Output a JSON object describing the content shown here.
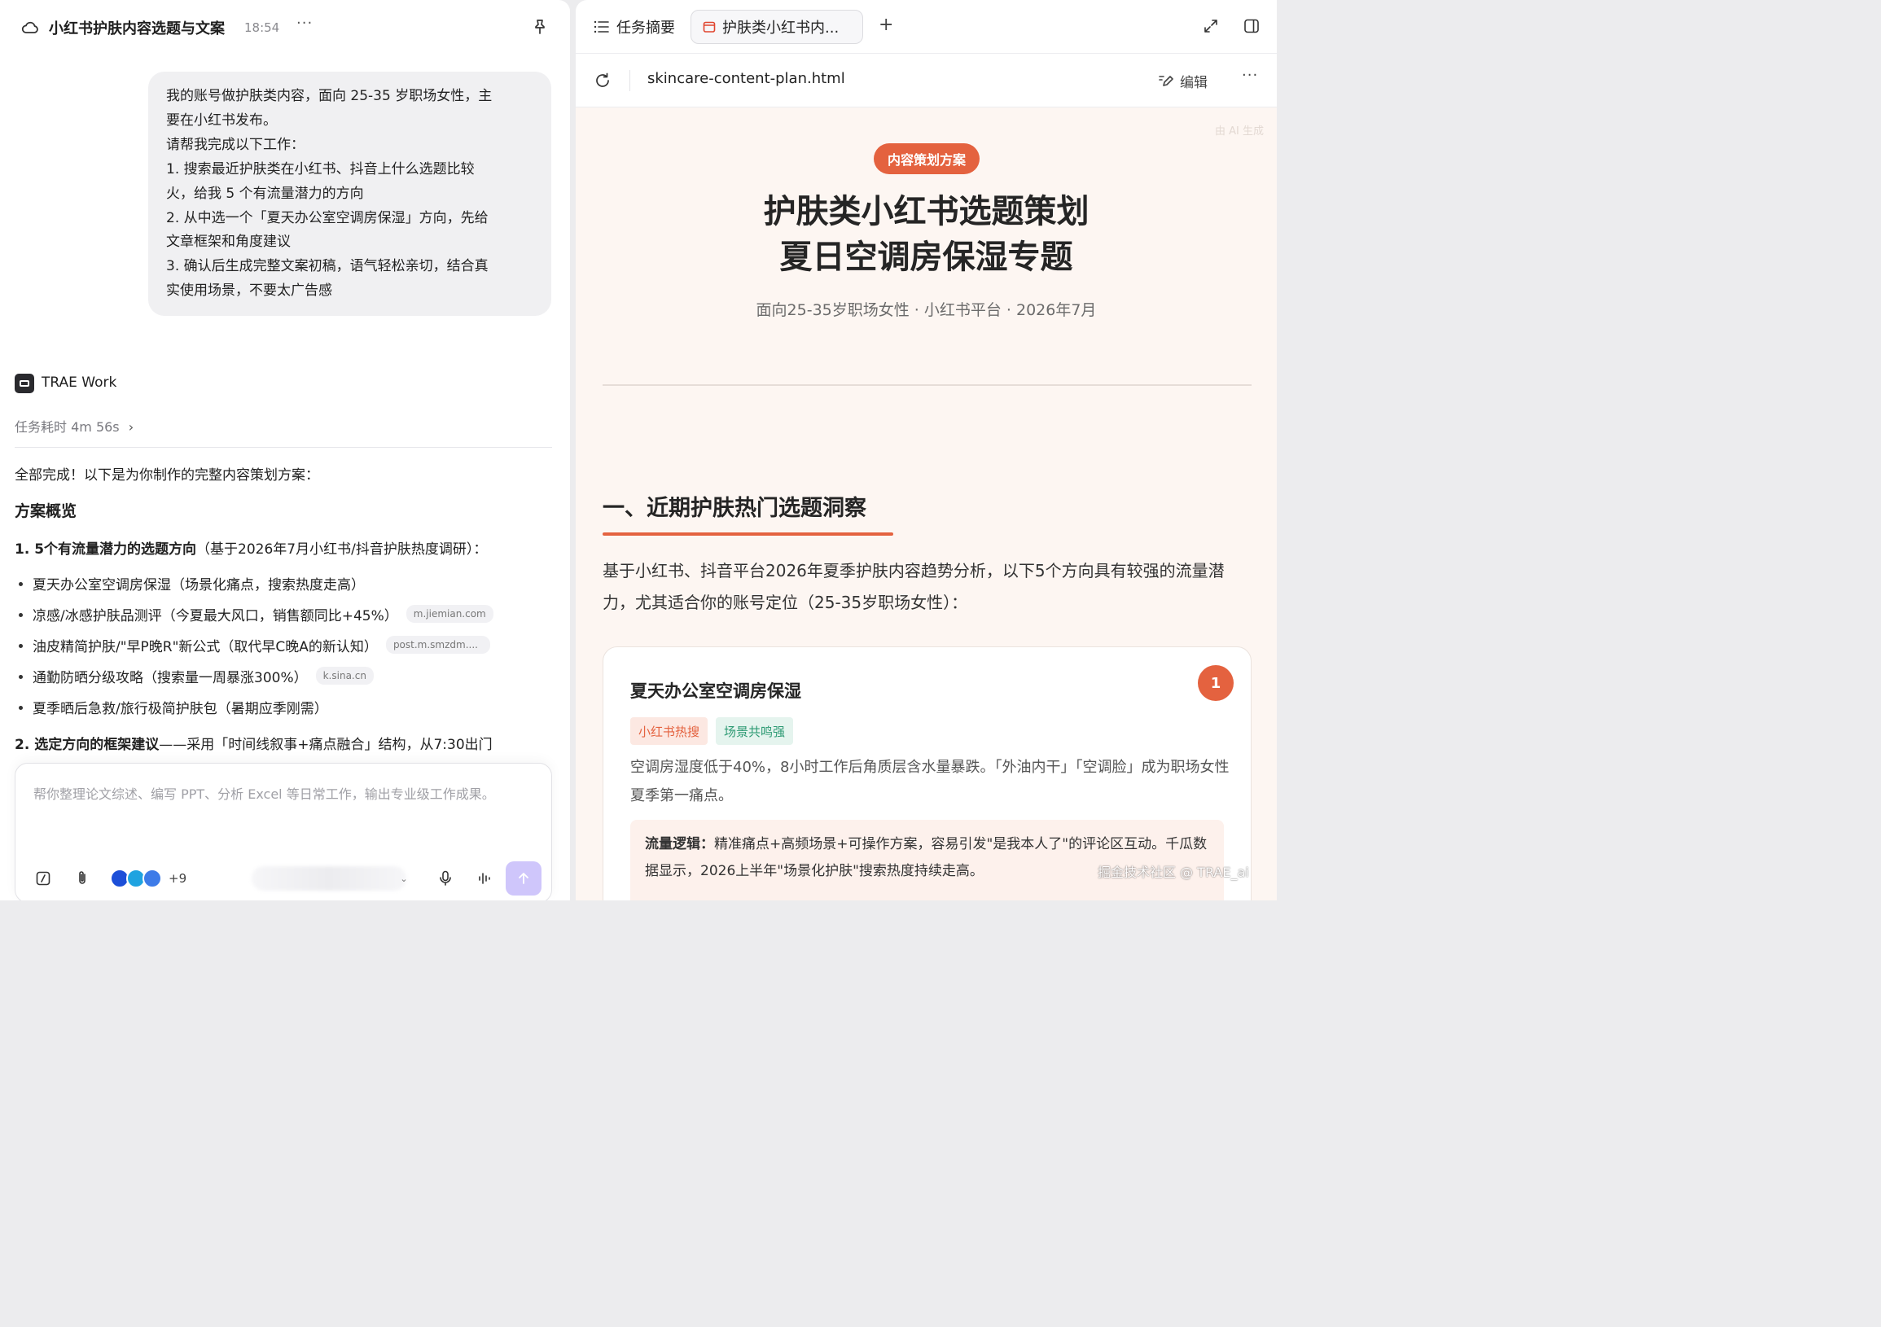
{
  "left_panel": {
    "header": {
      "title": "小红书护肤内容选题与文案",
      "time": "18:54",
      "more": "···"
    },
    "user_message": {
      "lines": [
        "我的账号做护肤类内容，面向 25-35 岁职场女性，主",
        "要在小红书发布。",
        "请帮我完成以下工作：",
        "1. 搜索最近护肤类在小红书、抖音上什么选题比较",
        "火，给我 5 个有流量潜力的方向",
        "2. 从中选一个「夏天办公室空调房保湿」方向，先给",
        "文章框架和角度建议",
        "3. 确认后生成完整文案初稿，语气轻松亲切，结合真",
        "实使用场景，不要太广告感"
      ]
    },
    "agent": {
      "name": "TRAE Work",
      "duration": "任务耗时 4m 56s",
      "duration_chevron": "›"
    },
    "response": {
      "done": "全部完成！以下是为你制作的完整内容策划方案：",
      "overview_heading": "方案概览",
      "section1_bold": "1. 5个有流量潜力的选题方向",
      "section1_rest": "（基于2026年7月小红书/抖音护肤热度调研）：",
      "bullets": [
        {
          "text": "夏天办公室空调房保湿（场景化痛点，搜索热度走高）",
          "source": ""
        },
        {
          "text": "凉感/冰感护肤品测评（今夏最大风口，销售额同比+45%）",
          "source": "m.jiemian.com"
        },
        {
          "text": "油皮精简护肤/\"早P晚R\"新公式（取代早C晚A的新认知）",
          "source": "post.m.smzdm...."
        },
        {
          "text": "通勤防晒分级攻略（搜索量一周暴涨300%）",
          "source": "k.sina.cn"
        },
        {
          "text": "夏季晒后急救/旅行极简护肤包（暑期应季刚需）",
          "source": ""
        }
      ],
      "section2_bold": "2. 选定方向的框架建议",
      "section2_rest": "——采用「时间线叙事+痛点融合」结构，从7:30出门"
    },
    "composer": {
      "placeholder": "帮你整理论文综述、编写 PPT、分析 Excel 等日常工作，输出专业级工作成果。",
      "more_apps": "+9",
      "caret": "⌄"
    }
  },
  "right_panel": {
    "tabs": {
      "summary_label": "任务摘要",
      "file_tab_label": "护肤类小红书内...",
      "add": "+"
    },
    "address": {
      "url": "skincare-content-plan.html",
      "edit_label": "编辑",
      "more": "···"
    },
    "doc": {
      "ai_generated": "由 AI 生成",
      "badge": "内容策划方案",
      "title_line1": "护肤类小红书选题策划",
      "title_line2": "夏日空调房保湿专题",
      "subtitle": "面向25-35岁职场女性 · 小红书平台 · 2026年7月",
      "section_title": "一、近期护肤热门选题洞察",
      "section_intro": "基于小红书、抖音平台2026年夏季护肤内容趋势分析，以下5个方向具有较强的流量潜力，尤其适合你的账号定位（25-35岁职场女性）：",
      "card": {
        "number": "1",
        "title": "夏天办公室空调房保湿",
        "tags": [
          "小红书热搜",
          "场景共鸣强"
        ],
        "description": "空调房湿度低于40%，8小时工作后角质层含水量暴跌。「外油内干」「空调脸」成为职场女性夏季第一痛点。",
        "logic_label": "流量逻辑：",
        "logic_text": "精准痛点+高频场景+可操作方案，容易引发\"是我本人了\"的评论区互动。千瓜数据显示，2026上半年\"场景化护肤\"搜索热度持续走高。"
      }
    }
  },
  "watermark": "掘金技术社区 @ TRAE_ai",
  "colors": {
    "accent": "#e4623f",
    "doc_background": "#fdf6f2",
    "tag_green": "#2d9a73",
    "send_button": "#cfc6fb"
  }
}
